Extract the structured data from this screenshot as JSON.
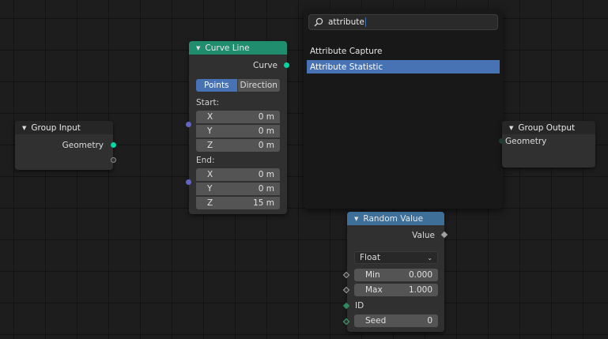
{
  "group_input": {
    "title": "Group Input",
    "output_geometry": "Geometry"
  },
  "group_output": {
    "title": "Group Output",
    "input_geometry": "Geometry"
  },
  "curve_line": {
    "title": "Curve Line",
    "output_curve": "Curve",
    "mode_points": "Points",
    "mode_direction": "Direction",
    "start_label": "Start:",
    "end_label": "End:",
    "start": [
      {
        "axis": "X",
        "value": "0 m"
      },
      {
        "axis": "Y",
        "value": "0 m"
      },
      {
        "axis": "Z",
        "value": "0 m"
      }
    ],
    "end": [
      {
        "axis": "X",
        "value": "0 m"
      },
      {
        "axis": "Y",
        "value": "0 m"
      },
      {
        "axis": "Z",
        "value": "15 m"
      }
    ]
  },
  "random_value": {
    "title": "Random Value",
    "output_value": "Value",
    "type_selected": "Float",
    "min_label": "Min",
    "min_value": "0.000",
    "max_label": "Max",
    "max_value": "1.000",
    "id_label": "ID",
    "seed_label": "Seed",
    "seed_value": "0"
  },
  "search": {
    "query": "attribute",
    "results": [
      "Attribute Capture",
      "Attribute Statistic"
    ],
    "active_index": 1
  },
  "colors": {
    "geometry_socket": "#00d6a3",
    "vector_socket": "#6363c7",
    "curve_header": "#1f8d6e",
    "random_header": "#3d6f99",
    "highlight": "#4772b3"
  }
}
